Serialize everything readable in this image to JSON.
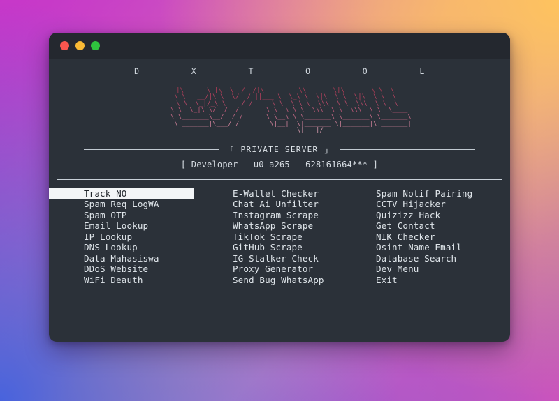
{
  "window": {
    "controls": [
      {
        "name": "close-button",
        "color": "#f9564f"
      },
      {
        "name": "minimize-button",
        "color": "#f9ba35"
      },
      {
        "name": "maximize-button",
        "color": "#2fc23e"
      }
    ]
  },
  "banner": {
    "letter_row": "D          X          T          O          O          L",
    "ascii_lines": [
      "    _______   ___    ___ _________  ________  ________  ___",
      "   |\\  ___ \\ |\\  \\  /  /|\\___   ___\\\\   __  \\|\\   __  \\|\\  \\",
      "   \\ \\   __/|\\ \\  \\/  / ||___ \\  \\_\\ \\  \\|\\  \\ \\  \\|\\  \\ \\  \\",
      "    \\ \\  \\_|/_\\ \\    / /     \\ \\  \\ \\ \\  \\\\\\  \\ \\  \\\\\\  \\ \\  \\",
      "     \\ \\  \\_|\\ \\/  /  /       \\ \\  \\ \\ \\  \\\\\\  \\ \\  \\\\\\  \\ \\  \\____",
      "      \\ \\_______\\__/  / /      \\ \\__\\ \\ \\_______\\ \\_______\\ \\_______\\",
      "       \\|_______|\\___/ /        \\|__|  \\|_______|\\|_______|\\|_______|",
      "                \\|___|/"
    ]
  },
  "private_server": {
    "left_bracket": "「",
    "label": "PRIVATE SERVER",
    "right_bracket": "」",
    "developer_line": "[ Developer - u0_a265 - 628161664*** ]"
  },
  "menu": {
    "columns": [
      {
        "name": "menu-column-1",
        "items": [
          {
            "label": "Track NO",
            "selected": true
          },
          {
            "label": "Spam Req LogWA",
            "selected": false
          },
          {
            "label": "Spam OTP",
            "selected": false
          },
          {
            "label": "Email Lookup",
            "selected": false
          },
          {
            "label": "IP Lookup",
            "selected": false
          },
          {
            "label": "DNS Lookup",
            "selected": false
          },
          {
            "label": "Data Mahasiswa",
            "selected": false
          },
          {
            "label": "DDoS Website",
            "selected": false
          },
          {
            "label": "WiFi Deauth",
            "selected": false
          }
        ]
      },
      {
        "name": "menu-column-2",
        "items": [
          {
            "label": "E-Wallet Checker",
            "selected": false
          },
          {
            "label": "Chat Ai Unfilter",
            "selected": false
          },
          {
            "label": "Instagram Scrape",
            "selected": false
          },
          {
            "label": "WhatsApp Scrape",
            "selected": false
          },
          {
            "label": "TikTok Scrape",
            "selected": false
          },
          {
            "label": "GitHub Scrape",
            "selected": false
          },
          {
            "label": "IG Stalker Check",
            "selected": false
          },
          {
            "label": "Proxy Generator",
            "selected": false
          },
          {
            "label": "Send Bug WhatsApp",
            "selected": false
          }
        ]
      },
      {
        "name": "menu-column-3",
        "items": [
          {
            "label": "Spam Notif Pairing",
            "selected": false
          },
          {
            "label": "CCTV Hijacker",
            "selected": false
          },
          {
            "label": "Quizizz Hack",
            "selected": false
          },
          {
            "label": "Get Contact",
            "selected": false
          },
          {
            "label": "NIK Checker",
            "selected": false
          },
          {
            "label": "Osint Name Email",
            "selected": false
          },
          {
            "label": "Database Search",
            "selected": false
          },
          {
            "label": "Dev Menu",
            "selected": false
          },
          {
            "label": "Exit",
            "selected": false
          }
        ]
      }
    ]
  },
  "colors": {
    "window_bg": "#2b3139",
    "titlebar_bg": "#24282f",
    "text": "#dfe5ea",
    "ascii_top": "#b23a52",
    "ascii_bottom": "#fafafa",
    "selection_bg": "#f3f5f7",
    "selection_text": "#20242a"
  }
}
